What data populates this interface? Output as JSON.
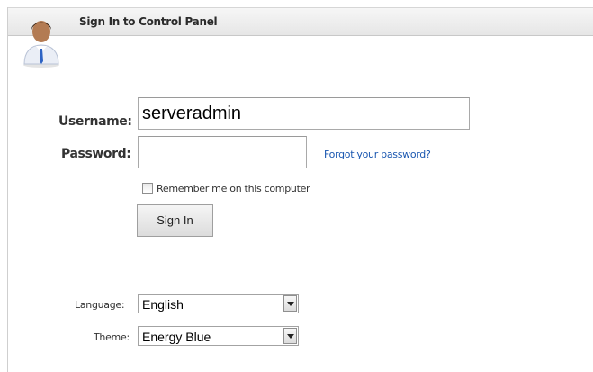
{
  "header": {
    "title": "Sign In to Control Panel",
    "avatar_icon": "user-avatar-icon"
  },
  "login": {
    "username_label": "Username:",
    "username_value": "serveradmin",
    "password_label": "Password:",
    "password_value": "",
    "forgot_link": "Forgot your password?",
    "remember_label": "Remember me on this computer",
    "remember_checked": false,
    "sign_in_label": "Sign In"
  },
  "preferences": {
    "language_label": "Language:",
    "language_value": "English",
    "theme_label": "Theme:",
    "theme_value": "Energy Blue"
  },
  "colors": {
    "link": "#1a57b0",
    "header_bg": "#e9e9e9"
  }
}
